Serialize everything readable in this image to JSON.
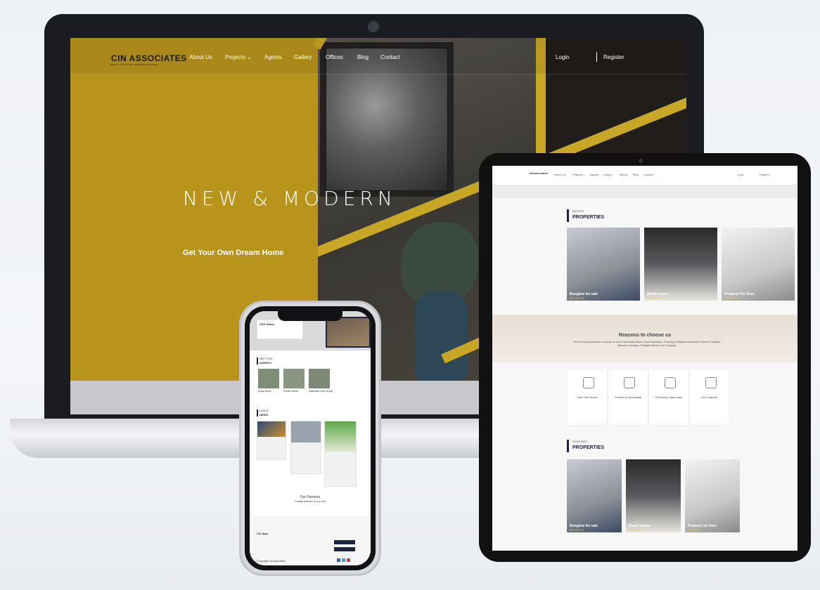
{
  "laptop": {
    "logo": "ASSOCIATES",
    "logo_mark": "CIN",
    "logo_tagline": "REAL ESTATE CONSULTANTS",
    "nav": [
      "About Us",
      "Projects ⌄",
      "Agents",
      "Gallery",
      "Offices",
      "Blog",
      "Contact"
    ],
    "login": "Login",
    "register": "Register",
    "hero_title": "NEW & MODERN",
    "hero_subtitle": "Get Your Own Dream Home"
  },
  "tablet": {
    "logo": "Cinassociates",
    "nav": [
      "About Us",
      "Projects ⌄",
      "Agents",
      "Gallery",
      "Offices",
      "Blog",
      "Contact"
    ],
    "login": "Login",
    "register": "Register",
    "recent_kicker": "RECENT",
    "recent_title": "PROPERTIES",
    "recent_cards": [
      {
        "title": "Bunglow for sale",
        "price": "$25,000.00"
      },
      {
        "title": "Beach house",
        "price": "$25,000.00"
      },
      {
        "title": "Property For Rent",
        "price": "$25,000.00"
      }
    ],
    "reasons_title": "Reasons to choose us",
    "reasons_text": "The Pinc!ourney reasons to choose us from Trust worthy Brand, Good Experience, Financing, Reliable Investments, Premium Facilities, Distinctive Designs, Profitable Return & 24x7 Support.",
    "features": [
      "Find Your Home",
      "Trusted by thousands",
      "Financing made easy",
      "24/7 support"
    ],
    "featured_kicker": "FEATURED",
    "featured_title": "PROPERTIES",
    "featured_cards": [
      {
        "title": "Bunglow for sale",
        "price": "$25,000.00"
      },
      {
        "title": "Beach house",
        "price": "$25,000.00"
      },
      {
        "title": "Property for Rent",
        "price": "$25,000.00"
      }
    ]
  },
  "phone": {
    "ceo_title": "CEO Notes",
    "agents_kicker": "MEET OUR",
    "agents_title": "AGENTS",
    "agents": [
      "Aman Arora",
      "Rohan Mehta",
      "Satbhalta Joshi Singh"
    ],
    "news_kicker": "LATEST",
    "news_title": "NEWS",
    "partners_title": "Our Partners",
    "partners_sub": "Trusted partners for our real",
    "footer_logo": "Cin Spur",
    "copyright": "© Copyright Cin Associates"
  },
  "colors": {
    "accent": "#b9941c",
    "navy": "#1d2340"
  }
}
